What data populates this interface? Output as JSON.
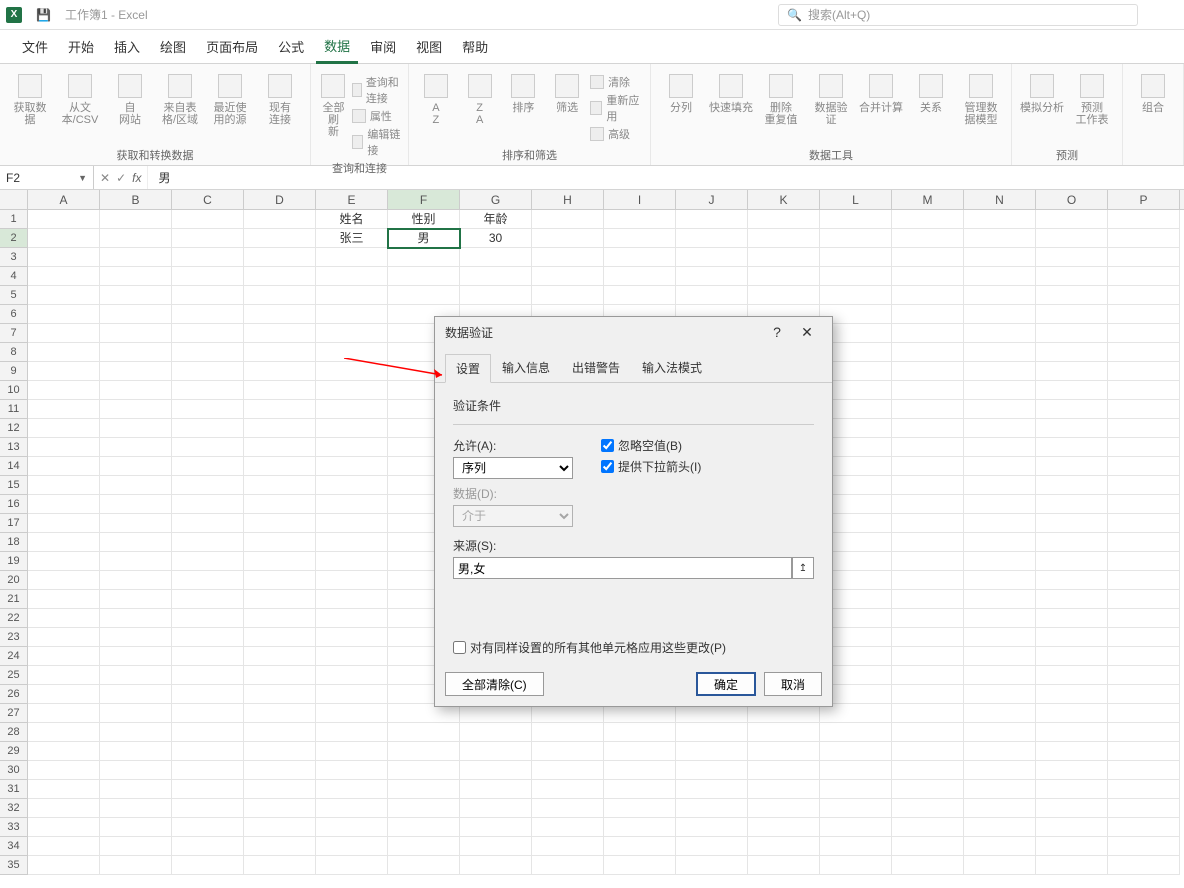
{
  "titlebar": {
    "doc_title": "工作簿1 - Excel",
    "search_placeholder": "搜索(Alt+Q)"
  },
  "tabs": [
    "文件",
    "开始",
    "插入",
    "绘图",
    "页面布局",
    "公式",
    "数据",
    "审阅",
    "视图",
    "帮助"
  ],
  "active_tab_index": 6,
  "ribbon": {
    "groups": [
      {
        "label": "获取和转换数据",
        "buttons": [
          {
            "label": "获取数\n据"
          },
          {
            "label": "从文\n本/CSV"
          },
          {
            "label": "自\n网站"
          },
          {
            "label": "来自表\n格/区域"
          },
          {
            "label": "最近使\n用的源"
          },
          {
            "label": "现有\n连接"
          }
        ]
      },
      {
        "label": "查询和连接",
        "buttons": [
          {
            "label": "全部刷\n新"
          }
        ],
        "minis": [
          "查询和连接",
          "属性",
          "编辑链接"
        ]
      },
      {
        "label": "排序和筛选",
        "buttons": [
          {
            "label": "A\nZ"
          },
          {
            "label": "Z\nA"
          },
          {
            "label": "排序"
          },
          {
            "label": "筛选"
          }
        ],
        "minis": [
          "清除",
          "重新应用",
          "高级"
        ]
      },
      {
        "label": "数据工具",
        "buttons": [
          {
            "label": "分列"
          },
          {
            "label": "快速填充"
          },
          {
            "label": "删除\n重复值"
          },
          {
            "label": "数据验\n证"
          },
          {
            "label": "合并计算"
          },
          {
            "label": "关系"
          },
          {
            "label": "管理数\n据模型"
          }
        ]
      },
      {
        "label": "预测",
        "buttons": [
          {
            "label": "模拟分析"
          },
          {
            "label": "预测\n工作表"
          }
        ]
      },
      {
        "label": "",
        "buttons": [
          {
            "label": "组合"
          }
        ]
      }
    ]
  },
  "formula_bar": {
    "cell_ref": "F2",
    "formula": "男"
  },
  "grid": {
    "col_headers": [
      "A",
      "B",
      "C",
      "D",
      "E",
      "F",
      "G",
      "H",
      "I",
      "J",
      "K",
      "L",
      "M",
      "N",
      "O",
      "P"
    ],
    "selected_col_index": 5,
    "selected_row_index": 1,
    "rows": [
      {
        "cells_override": {
          "4": "姓名",
          "5": "性别",
          "6": "年龄"
        }
      },
      {
        "cells_override": {
          "4": "张三",
          "5": "男",
          "6": "30"
        }
      }
    ],
    "row_count": 35
  },
  "dialog": {
    "title": "数据验证",
    "tabs": [
      "设置",
      "输入信息",
      "出错警告",
      "输入法模式"
    ],
    "active_tab_index": 0,
    "section_head": "验证条件",
    "allow_label": "允许(A):",
    "allow_value": "序列",
    "data_label": "数据(D):",
    "data_value": "介于",
    "ignore_blank_label": "忽略空值(B)",
    "ignore_blank_checked": true,
    "dropdown_label": "提供下拉箭头(I)",
    "dropdown_checked": true,
    "source_label": "来源(S):",
    "source_value": "男,女",
    "apply_to_others_label": "对有同样设置的所有其他单元格应用这些更改(P)",
    "apply_to_others_checked": false,
    "clear_all": "全部清除(C)",
    "ok": "确定",
    "cancel": "取消"
  }
}
